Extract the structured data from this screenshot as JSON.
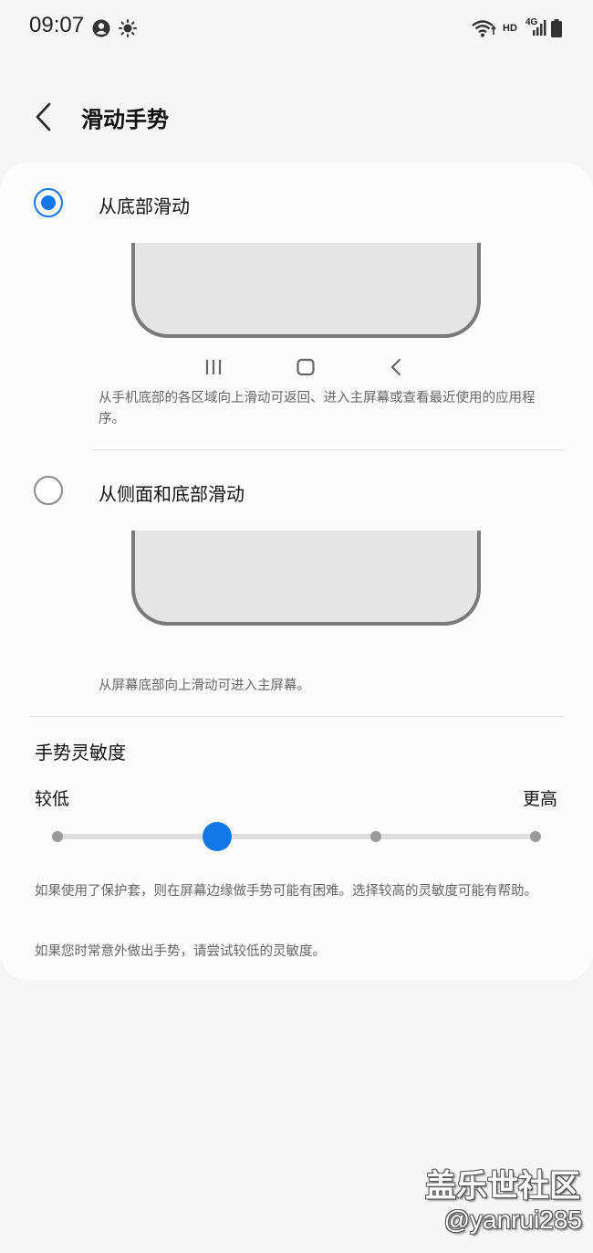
{
  "status_bar": {
    "time": "09:07",
    "hd_label": "HD",
    "network_label": "4G"
  },
  "header": {
    "title": "滑动手势"
  },
  "options": [
    {
      "label": "从底部滑动",
      "selected": true,
      "description": "从手机底部的各区域向上滑动可返回、进入主屏幕或查看最近使用的应用程序。"
    },
    {
      "label": "从侧面和底部滑动",
      "selected": false,
      "description": "从屏幕底部向上滑动可进入主屏幕。"
    }
  ],
  "sensitivity": {
    "title": "手势灵敏度",
    "low_label": "较低",
    "high_label": "更高",
    "steps": 4,
    "selected_step": 2,
    "note_1": "如果使用了保护套，则在屏幕边缘做手势可能有困难。选择较高的灵敏度可能有帮助。",
    "note_2": "如果您时常意外做出手势，请尝试较低的灵敏度。"
  },
  "watermark": {
    "line1": "盖乐世社区",
    "line2": "@yanrui285"
  },
  "colors": {
    "accent": "#1277e8",
    "background": "#f6f6f6",
    "card": "#fcfcfc"
  }
}
